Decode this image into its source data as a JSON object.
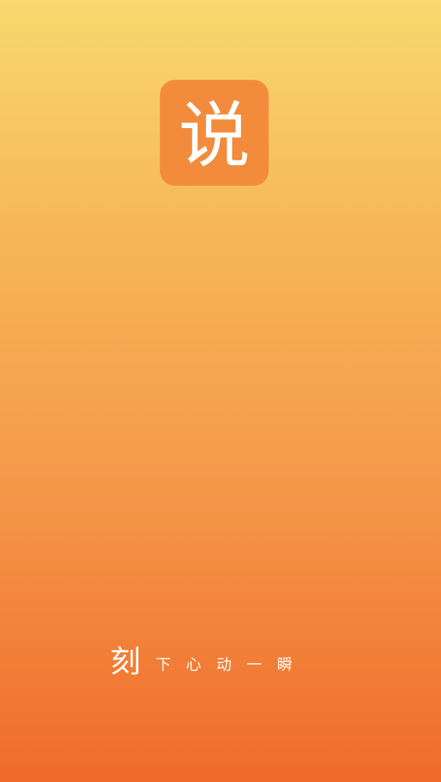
{
  "splash": {
    "background_colors": {
      "top": "#F9D86E",
      "bottom": "#F06A2C"
    },
    "app_icon": {
      "glyph": "说",
      "tile_color": "#F28C3C",
      "glyph_color": "#FFFFFF"
    },
    "slogan": {
      "lead": "刻",
      "chars": [
        "下",
        "心",
        "动",
        "一",
        "瞬"
      ]
    }
  }
}
